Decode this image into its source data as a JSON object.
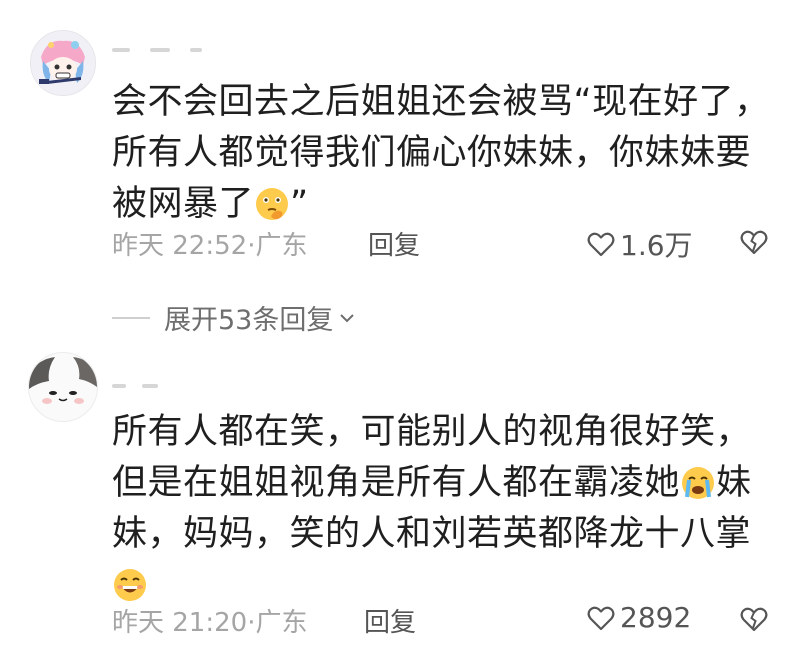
{
  "comments": [
    {
      "lines": [
        "会不会回去之后姐姐还会被骂“现在好了，",
        "所有人都觉得我们偏心你妹妹，你妹妹要",
        "被网暴了"
      ],
      "trailing": "”",
      "emoji": "thinking-face-emoji",
      "date": "昨天 22:52·广东",
      "reply_label": "回复",
      "likes": "1.6万"
    },
    {
      "lines": [
        "所有人都在笑，可能别人的视角很好笑，",
        "但是在姐姐视角是所有人都在霸凌她",
        "妹，妈妈，笑的人和刘若英都降龙十八掌"
      ],
      "line2_tail": "妹",
      "emoji_mid": "loudly-crying-face-emoji",
      "emoji_end": "grinning-squinting-face-emoji",
      "date": "昨天 21:20·广东",
      "reply_label": "回复",
      "likes": "2892"
    }
  ],
  "expand_replies": {
    "label": "展开53条回复"
  },
  "colors": {
    "text": "#1f1f1f",
    "meta": "#a5a5a5",
    "action": "#555555"
  }
}
